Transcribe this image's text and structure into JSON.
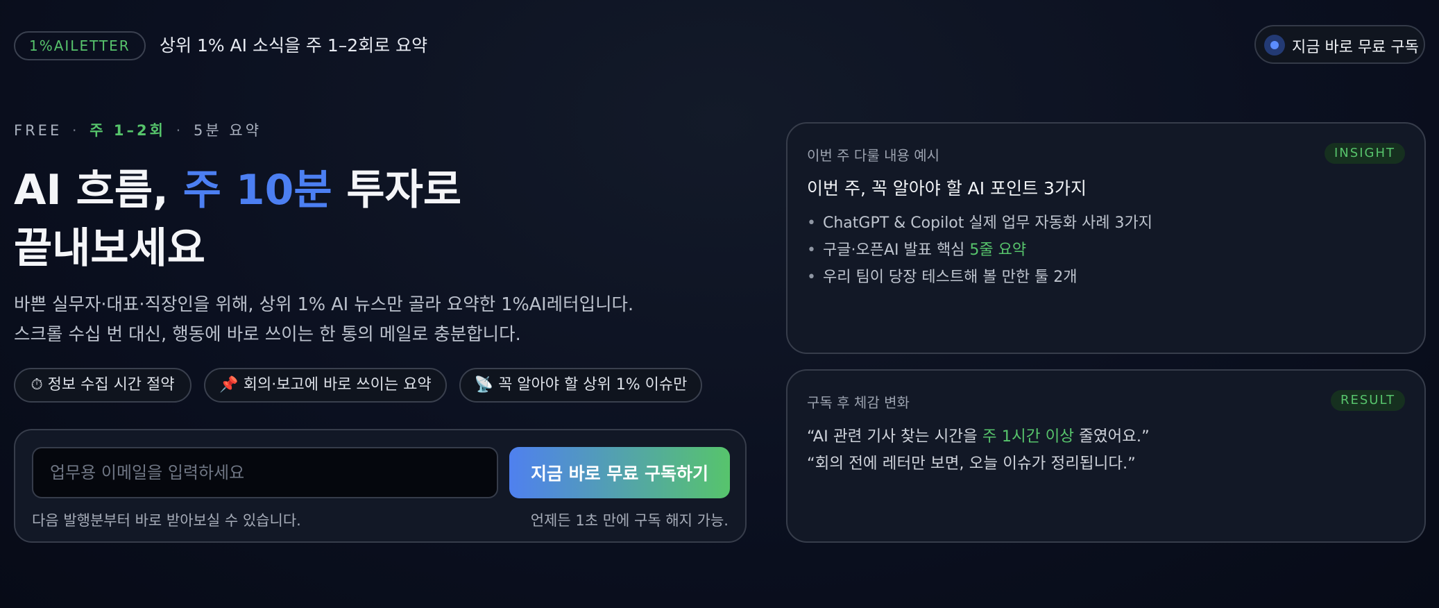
{
  "header": {
    "brand": "1%AILETTER",
    "tagline": "상위 1% AI 소식을 주 1–2회로 요약",
    "cta": "지금 바로 무료 구독"
  },
  "hero": {
    "kicker": {
      "part1": "FREE",
      "sep1": "·",
      "part2": "주 1–2회",
      "sep2": "·",
      "part3": "5분 요약"
    },
    "headline": {
      "line1_a": "AI 흐름, ",
      "line1_accent": "주 10분",
      "line1_b": " 투자로",
      "line2": "끝내보세요"
    },
    "lead": {
      "line1": "바쁜 실무자·대표·직장인을 위해, 상위 1% AI 뉴스만 골라 요약한 1%AI레터입니다.",
      "line2": "스크롤 수십 번 대신, 행동에 바로 쓰이는 한 통의 메일로 충분합니다."
    },
    "chips": [
      {
        "icon": "⏱",
        "label": "정보 수집 시간 절약"
      },
      {
        "icon": "📌",
        "label": "회의·보고에 바로 쓰이는 요약"
      },
      {
        "icon": "📡",
        "label": "꼭 알아야 할 상위 1% 이슈만"
      }
    ]
  },
  "form": {
    "email_placeholder": "업무용 이메일을 입력하세요",
    "submit_label": "지금 바로 무료 구독하기",
    "note_left": "다음 발행분부터 바로 받아보실 수 있습니다.",
    "note_right": "언제든 1초 만에 구독 해지 가능."
  },
  "insight_card": {
    "label": "이번 주 다룰 내용 예시",
    "badge": "INSIGHT",
    "title": "이번 주, 꼭 알아야 할 AI 포인트 3가지",
    "bullet_marker": "•",
    "item1": "ChatGPT & Copilot 실제 업무 자동화 사례 3가지",
    "item2_a": "구글·오픈AI 발표 핵심 ",
    "item2_hl": "5줄 요약",
    "item3": "우리 팀이 당장 테스트해 볼 만한 툴 2개"
  },
  "result_card": {
    "label": "구독 후 체감 변화",
    "badge": "RESULT",
    "quote1_a": "“AI 관련 기사 찾는 시간을 ",
    "quote1_hl": "주 1시간 이상",
    "quote1_b": " 줄였어요.”",
    "quote2": "“회의 전에 레터만 보면, 오늘 이슈가 정리됩니다.”"
  },
  "colors": {
    "accent_blue": "#4c7ff2",
    "accent_green": "#57c46c",
    "background": "#0b1020"
  }
}
